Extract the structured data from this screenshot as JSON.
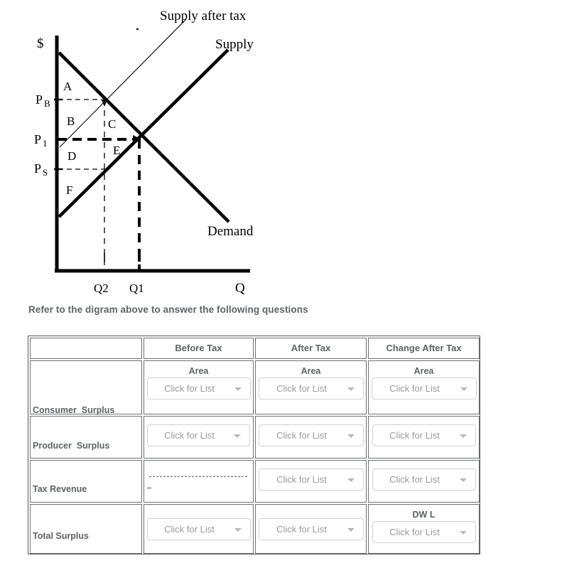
{
  "instruction": "Refer to the digram above to answer the following questions",
  "chart_data": {
    "type": "line",
    "title": "",
    "xlabel": "Q",
    "ylabel": "$",
    "grid": false,
    "legend_position": "inline-labels",
    "axis_labels": {
      "y_axis": "$",
      "x_axis": "Q"
    },
    "price_ticks": [
      {
        "label": "P",
        "sub": "B",
        "y_value": "PB"
      },
      {
        "label": "P",
        "sub": "1",
        "y_value": "P1"
      },
      {
        "label": "P",
        "sub": "S",
        "y_value": "Ps"
      }
    ],
    "quantity_ticks": [
      {
        "label": "Q2"
      },
      {
        "label": "Q1"
      }
    ],
    "curves": [
      {
        "name": "Demand",
        "label": "Demand",
        "style": "thick-solid",
        "slope": "negative"
      },
      {
        "name": "Supply",
        "label": "Supply",
        "style": "thick-solid",
        "slope": "positive"
      },
      {
        "name": "Supply after tax",
        "label": "Supply after tax",
        "style": "thin-solid",
        "slope": "positive"
      }
    ],
    "regions": [
      "A",
      "B",
      "C",
      "D",
      "E",
      "F"
    ],
    "annotations": [
      "Equilibrium before tax at (Q1, P1)",
      "Buyer price after tax PB at Q2",
      "Seller price after tax Ps at Q2"
    ]
  },
  "table": {
    "columns": [
      "",
      "Before Tax",
      "After Tax",
      "Change After Tax"
    ],
    "dropdown_placeholder": "Click for List",
    "area_caption": "Area",
    "dwl_caption": "DW L",
    "rows": [
      {
        "label": "Consumer  Surplus",
        "before": {
          "caption": "Area",
          "value": "Click for List"
        },
        "after": {
          "caption": "Area",
          "value": "Click for List"
        },
        "change": {
          "caption": "Area",
          "value": "Click for List"
        }
      },
      {
        "label": "Producer  Surplus",
        "before": {
          "caption": "",
          "value": "Click for List"
        },
        "after": {
          "caption": "",
          "value": "Click for List"
        },
        "change": {
          "caption": "",
          "value": "Click for List"
        }
      },
      {
        "label": "Tax Revenue",
        "before": {
          "caption": "",
          "value": ""
        },
        "after": {
          "caption": "",
          "value": "Click for List"
        },
        "change": {
          "caption": "",
          "value": "Click for List"
        }
      },
      {
        "label": "Total Surplus",
        "before": {
          "caption": "",
          "value": "Click for List"
        },
        "after": {
          "caption": "",
          "value": "Click for List"
        },
        "change": {
          "caption": "DW L",
          "value": "Click for List"
        }
      }
    ]
  },
  "colors": {
    "text_gray": "#5e6366",
    "placeholder_gray": "#9b9b9b",
    "border_gray": "#6d7174",
    "dropdown_border": "#d2d2d2",
    "diagram_black": "#000000"
  }
}
